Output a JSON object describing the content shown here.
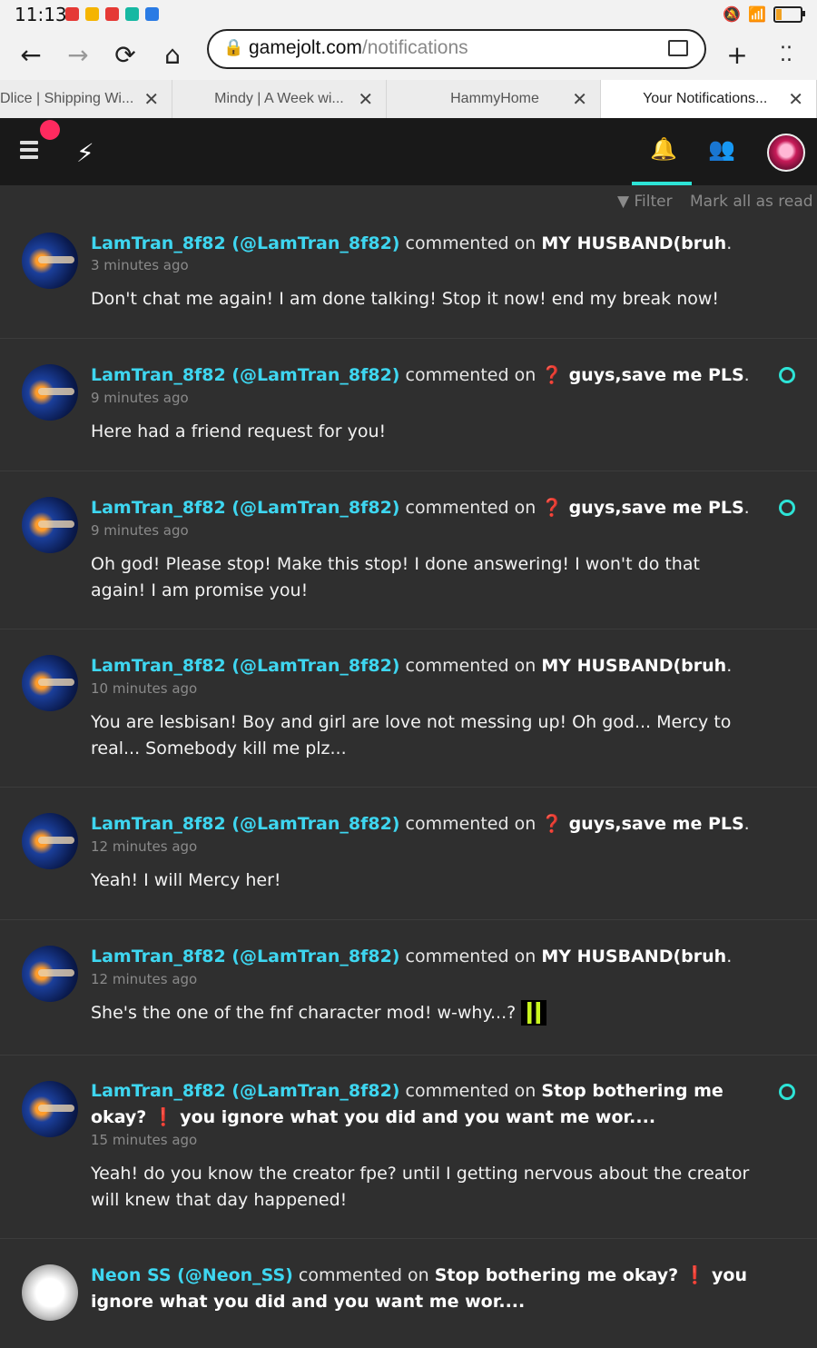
{
  "status_bar": {
    "time": "11:13"
  },
  "browser": {
    "url_domain": "gamejolt.com",
    "url_path": "/notifications",
    "tabs": [
      {
        "label": "Dlice | Shipping Wi..."
      },
      {
        "label": "Mindy | A Week wi..."
      },
      {
        "label": "HammyHome"
      },
      {
        "label": "Your Notifications..."
      }
    ],
    "tab_close": "✕"
  },
  "gamejolt": {
    "filter_label": "Filter",
    "mark_all_label": "Mark all as read"
  },
  "notifications": [
    {
      "user": "LamTran_8f82 (@LamTran_8f82)",
      "verb": "commented on",
      "target": "MY HUSBAND(bruh",
      "time": "3 minutes ago",
      "body": "Don't chat me again! I am done talking! Stop it now! end my break now!",
      "unread": false
    },
    {
      "user": "LamTran_8f82 (@LamTran_8f82)",
      "verb": "commented on",
      "target": "❓ guys,save me PLS",
      "time": "9 minutes ago",
      "body": "Here had a friend request for you!",
      "unread": true
    },
    {
      "user": "LamTran_8f82 (@LamTran_8f82)",
      "verb": "commented on",
      "target": "❓ guys,save me PLS",
      "time": "9 minutes ago",
      "body": "Oh god! Please stop! Make this stop! I done answering! I won't do that again! I am promise you!",
      "unread": true
    },
    {
      "user": "LamTran_8f82 (@LamTran_8f82)",
      "verb": "commented on",
      "target": "MY HUSBAND(bruh",
      "time": "10 minutes ago",
      "body": "You are lesbisan! Boy and girl are love not messing up! Oh god... Mercy to real... Somebody kill me plz...",
      "unread": false
    },
    {
      "user": "LamTran_8f82 (@LamTran_8f82)",
      "verb": "commented on",
      "target": "❓ guys,save me PLS",
      "time": "12 minutes ago",
      "body": "Yeah! I will Mercy her!",
      "unread": false
    },
    {
      "user": "LamTran_8f82 (@LamTran_8f82)",
      "verb": "commented on",
      "target": "MY HUSBAND(bruh",
      "time": "12 minutes ago",
      "body": "She's the one of the fnf character mod! w-why...?",
      "unread": false
    },
    {
      "user": "LamTran_8f82 (@LamTran_8f82)",
      "verb": "commented on",
      "target": "Stop bothering me okay? ❗ you ignore what you did and you want me wor....",
      "time": "15 minutes ago",
      "body": "Yeah! do you know the creator fpe? until I getting nervous about the creator will knew that day happened!",
      "unread": true
    },
    {
      "user": "Neon SS (@Neon_SS)",
      "verb": "commented on",
      "target": "Stop bothering me okay? ❗ you ignore what you did and you want me wor....",
      "time": "",
      "body": "",
      "unread": false
    }
  ]
}
